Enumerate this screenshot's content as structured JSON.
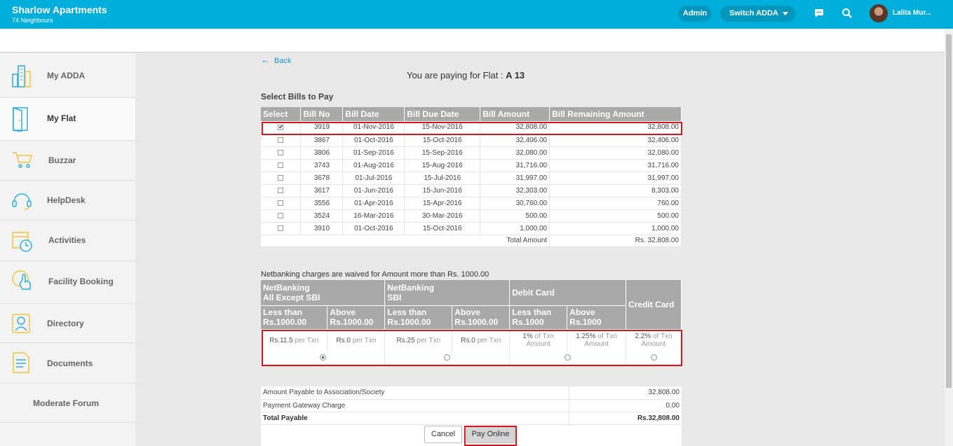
{
  "header": {
    "app_title": "Sharlow Apartments",
    "subtitle": "74 Neighbours",
    "admin_label": "Admin",
    "switch_label": "Switch ADDA",
    "user_name": "Lalita Mur..."
  },
  "sidebar": {
    "items": [
      {
        "label": "My ADDA",
        "icon": "buildings-icon"
      },
      {
        "label": "My Flat",
        "icon": "door-icon"
      },
      {
        "label": "Buzzar",
        "icon": "cart-icon"
      },
      {
        "label": "HelpDesk",
        "icon": "headset-icon"
      },
      {
        "label": "Activities",
        "icon": "calendar-clock-icon"
      },
      {
        "label": "Facility Booking",
        "icon": "hand-pointer-icon"
      },
      {
        "label": "Directory",
        "icon": "person-icon"
      },
      {
        "label": "Documents",
        "icon": "document-icon"
      },
      {
        "label": "Moderate Forum",
        "icon": ""
      }
    ]
  },
  "main": {
    "back_label": "Back",
    "paying_prefix": "You are paying for Flat : ",
    "flat": "A 13",
    "select_title": "Select Bills to Pay",
    "bill_headers": [
      "Select",
      "Bill No",
      "Bill Date",
      "Bill Due Date",
      "Bill Amount",
      "Bill Remaining Amount"
    ],
    "bills": [
      {
        "checked": true,
        "no": "3919",
        "date": "01-Nov-2016",
        "due": "15-Nov-2016",
        "amount": "32,808.00",
        "remaining": "32,808.00"
      },
      {
        "checked": false,
        "no": "3867",
        "date": "01-Oct-2016",
        "due": "15-Oct-2016",
        "amount": "32,406.00",
        "remaining": "32,406.00"
      },
      {
        "checked": false,
        "no": "3806",
        "date": "01-Sep-2016",
        "due": "15-Sep-2016",
        "amount": "32,080.00",
        "remaining": "32,080.00"
      },
      {
        "checked": false,
        "no": "3743",
        "date": "01-Aug-2016",
        "due": "15-Aug-2016",
        "amount": "31,716.00",
        "remaining": "31,716.00"
      },
      {
        "checked": false,
        "no": "3678",
        "date": "01-Jul-2016",
        "due": "15-Jul-2016",
        "amount": "31,997.00",
        "remaining": "31,997.00"
      },
      {
        "checked": false,
        "no": "3617",
        "date": "01-Jun-2016",
        "due": "15-Jun-2016",
        "amount": "32,303.00",
        "remaining": "8,303.00"
      },
      {
        "checked": false,
        "no": "3556",
        "date": "01-Apr-2016",
        "due": "15-Apr-2016",
        "amount": "30,760.00",
        "remaining": "760.00"
      },
      {
        "checked": false,
        "no": "3524",
        "date": "16-Mar-2016",
        "due": "30-Mar-2016",
        "amount": "500.00",
        "remaining": "500.00"
      },
      {
        "checked": false,
        "no": "3910",
        "date": "01-Oct-2016",
        "due": "15-Oct-2016",
        "amount": "1,000.00",
        "remaining": "1,000.00"
      }
    ],
    "total_label": "Total Amount",
    "total_value": "Rs. 32,808.00",
    "netbanking_note": "Netbanking charges are waived for Amount more than Rs. 1000.00",
    "charges": {
      "groups": [
        {
          "line1": "NetBanking",
          "line2": "All Except SBI"
        },
        {
          "line1": "NetBanking",
          "line2": "SBI"
        },
        {
          "line1": "Debit Card",
          "line2": ""
        },
        {
          "line1": "Credit Card",
          "line2": ""
        }
      ],
      "subheaders": [
        {
          "line1": "Less than",
          "line2": "Rs.1000.00"
        },
        {
          "line1": "Above",
          "line2": "Rs.1000.00"
        },
        {
          "line1": "Less than",
          "line2": "Rs.1000.00"
        },
        {
          "line1": "Above",
          "line2": "Rs.1000.00"
        },
        {
          "line1": "Less than",
          "line2": "Rs.1000"
        },
        {
          "line1": "Above",
          "line2": "Rs.1000"
        }
      ],
      "rates": [
        {
          "value": "Rs.11.5",
          "unit": "per Txn"
        },
        {
          "value": "Rs.0",
          "unit": "per Txn"
        },
        {
          "value": "Rs.25",
          "unit": "per Txn"
        },
        {
          "value": "Rs.0",
          "unit": "per Txn"
        },
        {
          "value": "1%",
          "unit": "of Txn Amount"
        },
        {
          "value": "1.25%",
          "unit": "of Txn Amount"
        },
        {
          "value": "2.2%",
          "unit": "of Txn Amount"
        }
      ],
      "selected_option": "NetBanking All Except SBI"
    },
    "summary": {
      "rows": [
        {
          "label": "Amount Payable to Association/Society",
          "value": "32,808.00"
        },
        {
          "label": "Payment Gateway Charge",
          "value": "0.00"
        },
        {
          "label": "Total Payable",
          "value": "Rs.32,808.00"
        }
      ],
      "cancel_label": "Cancel",
      "pay_label": "Pay Online"
    }
  },
  "colors": {
    "topbar": "#00aedb",
    "pill": "#0497bd",
    "table_header": "#a9a9a9",
    "highlight": "#d9141b",
    "link": "#1a97c8"
  }
}
